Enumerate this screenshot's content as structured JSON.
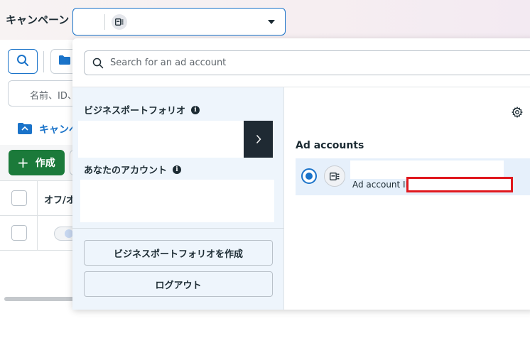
{
  "header": {
    "title": "キャンペーン"
  },
  "background": {
    "filter_placeholder": "名前、ID、",
    "tab_label": "キャンペ",
    "create_label": "作成",
    "table_header_toggle": "オフ/オ"
  },
  "dropdown": {
    "search_placeholder": "Search for an ad account",
    "business_portfolio_label": "ビジネスポートフォリオ",
    "your_accounts_label": "あなたのアカウント",
    "create_portfolio_button": "ビジネスポートフォリオを作成",
    "logout_button": "ログアウト",
    "ad_accounts_title": "Ad accounts",
    "ad_accounts": [
      {
        "id_label": "Ad account ID:",
        "selected": true
      }
    ]
  },
  "icons": {
    "search": "search-icon",
    "folder": "folder-icon",
    "settings": "gear-icon",
    "info": "info-icon",
    "account": "ad-account-icon"
  },
  "colors": {
    "accent": "#1a73c9",
    "create_button": "#1b7a3a",
    "dark_arrow": "#1f2a33",
    "left_pane_bg": "#eef5fc",
    "selected_row_bg": "#e6f0fb",
    "redaction_border": "#e0181e"
  }
}
